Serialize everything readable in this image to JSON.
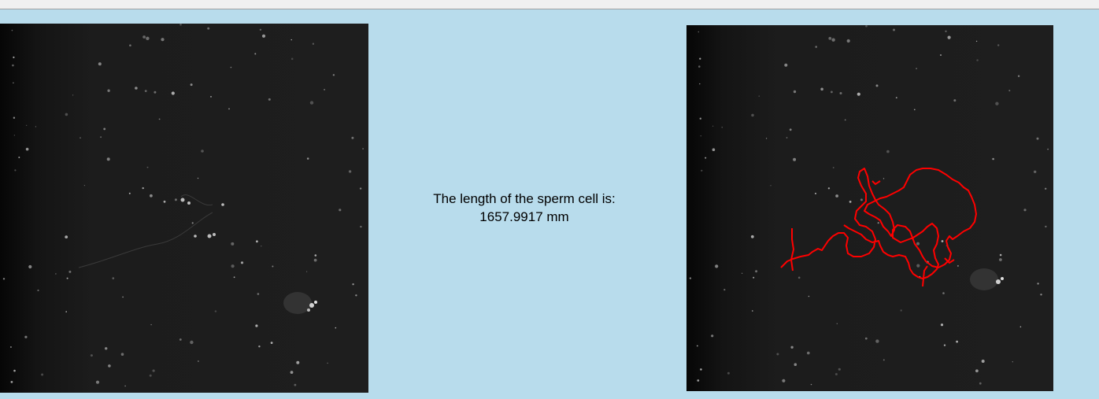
{
  "result": {
    "label": "The length of the sperm cell is:",
    "value": "1657.9917 mm"
  },
  "images": {
    "original": {
      "icon": "microscopy-image"
    },
    "traced": {
      "icon": "microscopy-image-with-trace",
      "trace_color": "#ff0000"
    }
  },
  "colors": {
    "background": "#b8dcec",
    "image_background": "#1c1c1c"
  }
}
